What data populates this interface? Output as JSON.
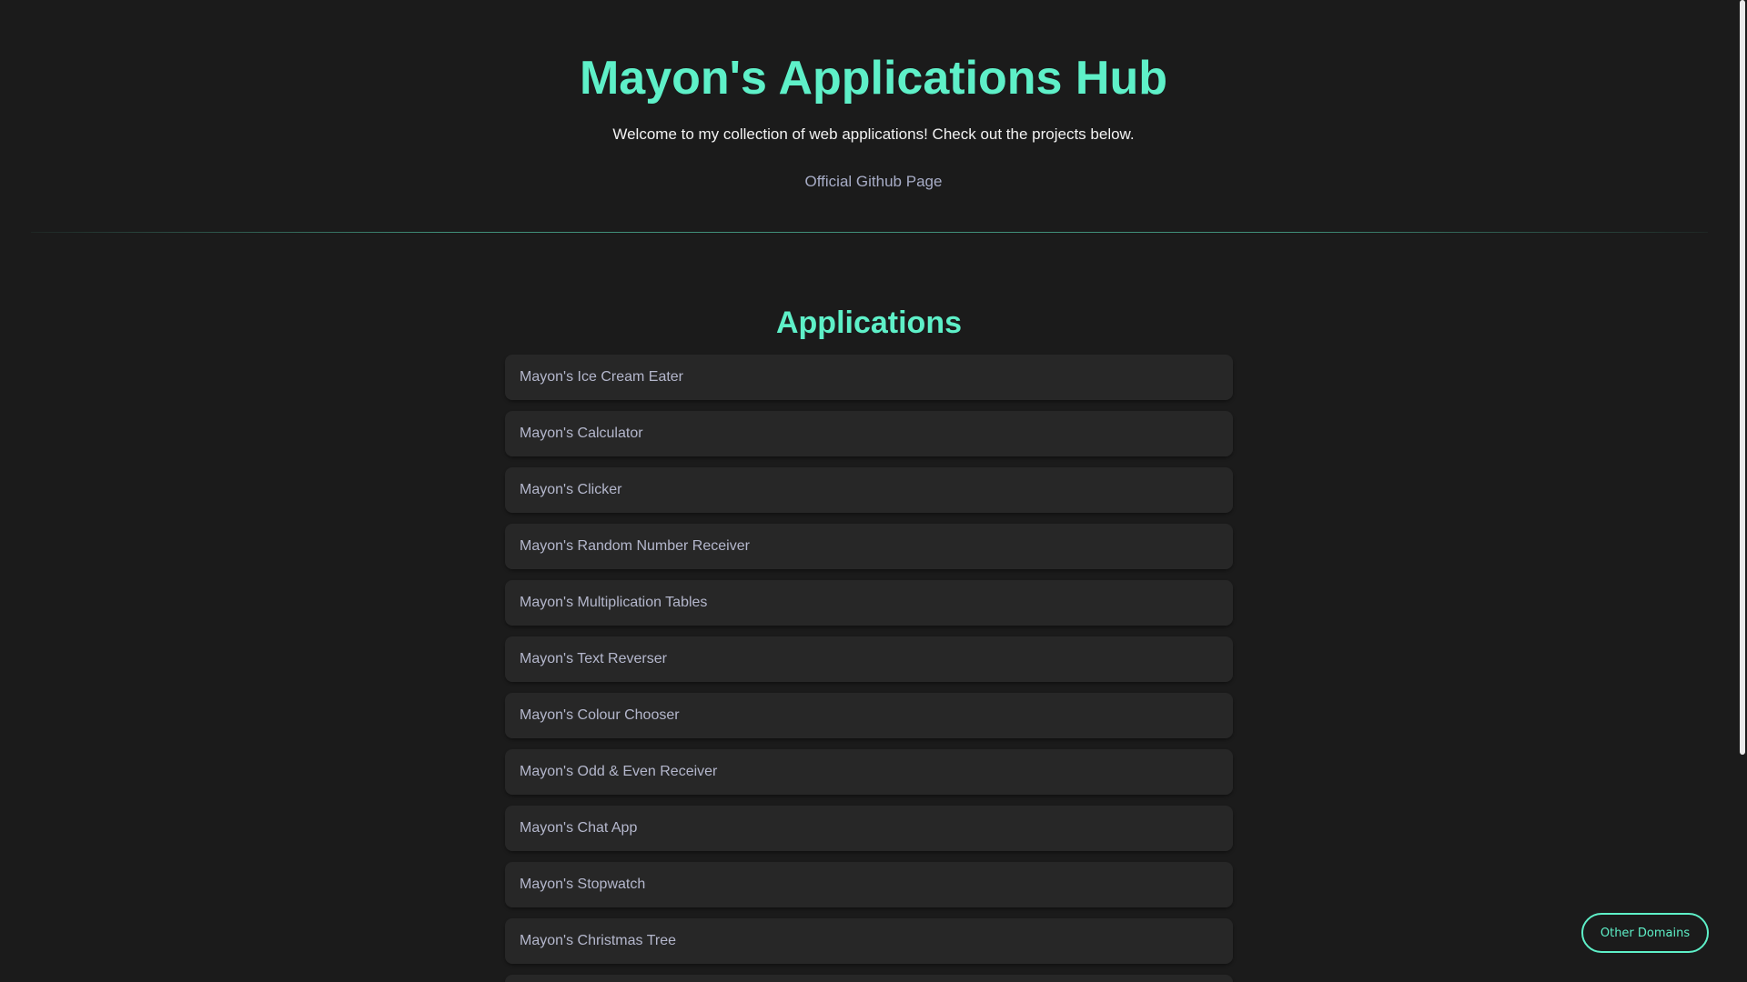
{
  "header": {
    "title": "Mayon's Applications Hub",
    "subtitle": "Welcome to my collection of web applications! Check out the projects below.",
    "github_link": "Official Github Page"
  },
  "applications": {
    "title": "Applications",
    "items": [
      {
        "label": "Mayon's Ice Cream Eater"
      },
      {
        "label": "Mayon's Calculator"
      },
      {
        "label": "Mayon's Clicker"
      },
      {
        "label": "Mayon's Random Number Receiver"
      },
      {
        "label": "Mayon's Multiplication Tables"
      },
      {
        "label": "Mayon's Text Reverser"
      },
      {
        "label": "Mayon's Colour Chooser"
      },
      {
        "label": "Mayon's Odd & Even Receiver"
      },
      {
        "label": "Mayon's Chat App"
      },
      {
        "label": "Mayon's Stopwatch"
      },
      {
        "label": "Mayon's Christmas Tree"
      },
      {
        "label": ""
      }
    ]
  },
  "floating_button": {
    "label": "Other Domains"
  },
  "colors": {
    "background": "#1b1b1b",
    "accent": "#5ef0c8",
    "card": "#272727",
    "link": "#a7acc6"
  }
}
